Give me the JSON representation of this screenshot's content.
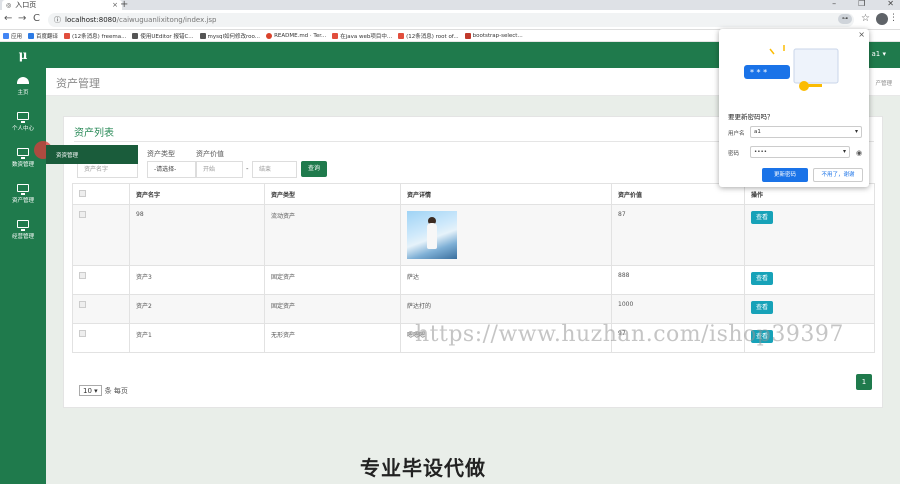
{
  "browser": {
    "tab_title": "入口页",
    "tab_close": "×",
    "new_tab": "+",
    "window_controls": [
      "–",
      "❐",
      "✕"
    ],
    "nav": {
      "back": "←",
      "forward": "→",
      "reload": "C"
    },
    "url_host": "localhost:8080",
    "url_path": "/caiwuguanlixitong/index.jsp",
    "key_icon": "⊶",
    "star": "☆",
    "menu": "⋮",
    "bookmarks": [
      {
        "label": "应用",
        "color": "#4285f4"
      },
      {
        "label": "百度翻译",
        "color": "#2d7be5"
      },
      {
        "label": "(12条消息) freema...",
        "color": "#e14e3d"
      },
      {
        "label": "使用UEditor 报错C...",
        "color": "#555555"
      },
      {
        "label": "mysql如何修改roo...",
        "color": "#555555"
      },
      {
        "label": "README.md · Ter...",
        "color": "#d9422b"
      },
      {
        "label": "在java web项目中...",
        "color": "#e14e3d"
      },
      {
        "label": "(12条消息) root of...",
        "color": "#e14e3d"
      },
      {
        "label": "bootstrap-select...",
        "color": "#c0392b"
      }
    ]
  },
  "app": {
    "logo": "μ",
    "user_menu": "a1 ▾",
    "sidebar": [
      {
        "label": "主页",
        "icon": "gauge-icon"
      },
      {
        "label": "个人中心",
        "icon": "monitor-icon"
      },
      {
        "label": "数资管理",
        "icon": "monitor-icon"
      },
      {
        "label": "资产管理",
        "icon": "monitor-icon"
      },
      {
        "label": "经营管理",
        "icon": "monitor-icon"
      }
    ],
    "flyout_item": "资资管理",
    "page_title": "资产管理",
    "breadcrumb": "产管理",
    "panel_title": "资产列表",
    "filters": {
      "type_label": "资产类型",
      "value_label": "资产价值",
      "name_placeholder": "资产名字",
      "type_select": "-请选择-",
      "start_placeholder": "开始",
      "dash": "-",
      "end_placeholder": "结束",
      "query_button": "查询"
    },
    "table": {
      "headers": [
        "",
        "资产名字",
        "资产类型",
        "资产详情",
        "资产价值",
        "操作"
      ],
      "rows": [
        {
          "name": "98",
          "type": "流动资产",
          "detail": "",
          "has_image": true,
          "value": "87",
          "action": "查看"
        },
        {
          "name": "资产3",
          "type": "固定资产",
          "detail": "萨达",
          "has_image": false,
          "value": "888",
          "action": "查看"
        },
        {
          "name": "资产2",
          "type": "固定资产",
          "detail": "萨达打的",
          "has_image": false,
          "value": "1000",
          "action": "查看"
        },
        {
          "name": "资产1",
          "type": "无形资产",
          "detail": "嗯嗯嗯",
          "has_image": false,
          "value": "97",
          "action": "查看"
        }
      ]
    },
    "page_size": "10 ▾",
    "page_size_suffix": "条 每页",
    "current_page": "1"
  },
  "password_popup": {
    "close": "×",
    "question": "要更新密码吗？",
    "username_label": "用户名",
    "username_value": "a1",
    "password_label": "密码",
    "password_value": "••••",
    "update_button": "更新密码",
    "no_button": "不用了，谢谢"
  },
  "overlay": {
    "watermark": "https://www.huzhan.com/ishop39397",
    "bottom_caption": "专业毕设代做"
  }
}
